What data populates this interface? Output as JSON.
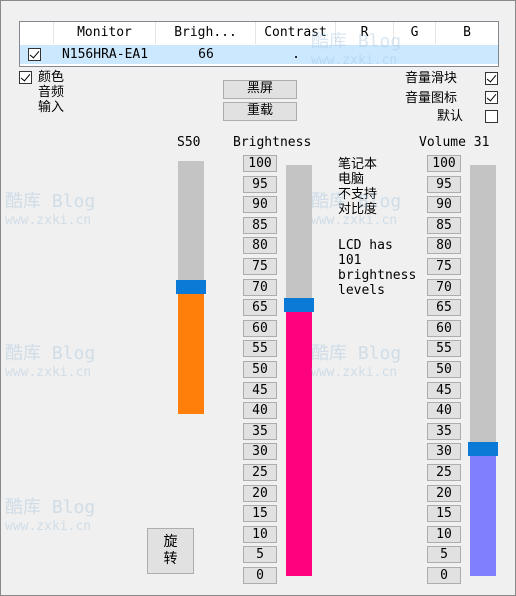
{
  "listview": {
    "columns": [
      "Monitor",
      "Brigh...",
      "Contrast",
      "R",
      "G",
      "B"
    ],
    "row": {
      "checked": true,
      "monitor": "N156HRA-EA1",
      "brightness": "66",
      "contrast": ".",
      "r": "",
      "g": "",
      "b": ""
    }
  },
  "left_options": [
    {
      "label": "颜色",
      "checked": true
    },
    {
      "label": "音频"
    },
    {
      "label": "输入"
    }
  ],
  "buttons": {
    "blackscreen": "黑屏",
    "reload": "重载",
    "rotate": "旋转"
  },
  "right_options": [
    {
      "label": "音量滑块",
      "checked": true
    },
    {
      "label": "音量图标",
      "checked": true
    },
    {
      "label": "默认",
      "checked": false
    }
  ],
  "s_slider": {
    "label": "S50",
    "value": 50,
    "color": "#ff7f0a"
  },
  "brightness_slider": {
    "label": "Brightness",
    "value": 66,
    "color": "#ff007f"
  },
  "volume_slider": {
    "label": "Volume 31",
    "value": 31,
    "color": "#8080ff"
  },
  "ticks": [
    "100",
    "95",
    "90",
    "85",
    "80",
    "75",
    "70",
    "65",
    "60",
    "55",
    "50",
    "45",
    "40",
    "35",
    "30",
    "25",
    "20",
    "15",
    "10",
    "5",
    "0"
  ],
  "notes": {
    "line1": "笔记本",
    "line2": "电脑",
    "line3": "不支持",
    "line4": "对比度",
    "line5": "LCD has",
    "line6": "101",
    "line7": "brightness",
    "line8": "levels"
  },
  "watermark": {
    "text": "酷库 Blog",
    "url": "www.zxki.cn"
  }
}
